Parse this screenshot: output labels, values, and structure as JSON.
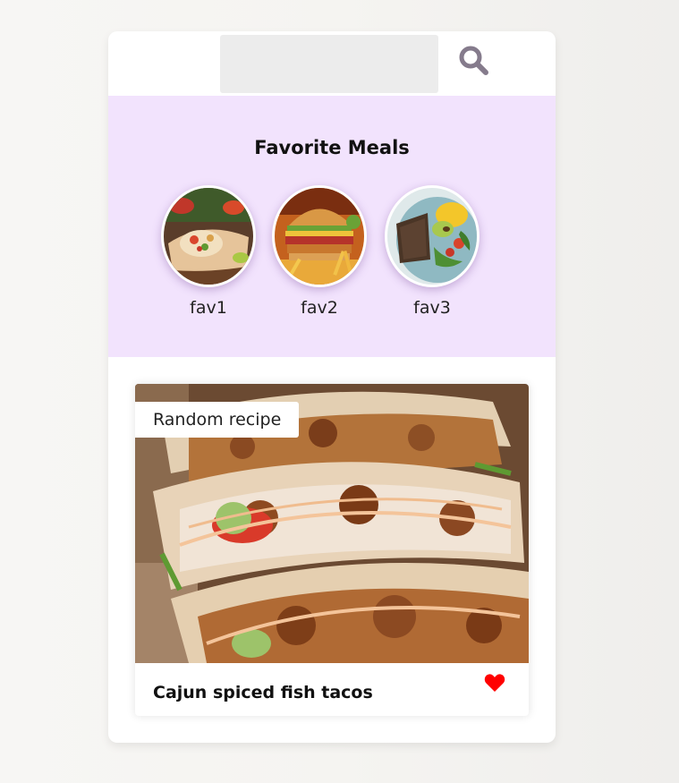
{
  "search": {
    "placeholder": "",
    "value": "",
    "button_icon": "search-icon",
    "icon_color": "#857b8c"
  },
  "favorites": {
    "title": "Favorite Meals",
    "items": [
      {
        "label": "fav1",
        "image": "burrito-wrap-image"
      },
      {
        "label": "fav2",
        "image": "burger-fries-image"
      },
      {
        "label": "fav3",
        "image": "salad-bowl-image"
      }
    ],
    "background": "#f2e3fd"
  },
  "recipe": {
    "tag": "Random recipe",
    "title": "Cajun spiced fish tacos",
    "image": "fish-tacos-image",
    "favorite_icon": "heart-icon",
    "favorite_color": "#ff0000",
    "favorited": true
  }
}
